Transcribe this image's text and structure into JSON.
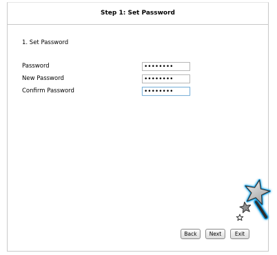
{
  "header": {
    "title": "Step 1: Set Password"
  },
  "section": {
    "title": "1. Set Password"
  },
  "fields": {
    "password": {
      "label": "Password",
      "value": "••••••••"
    },
    "new_password": {
      "label": "New Password",
      "value": "••••••••"
    },
    "confirm_password": {
      "label": "Confirm Password",
      "value": "••••••••"
    }
  },
  "buttons": {
    "back": "Back",
    "next": "Next",
    "exit": "Exit"
  },
  "icons": {
    "wizard": "magic-wand-icon"
  },
  "colors": {
    "focus_border": "#7fb3d9",
    "border": "#c8c8c8",
    "wand_glow": "#1aa3e6"
  }
}
